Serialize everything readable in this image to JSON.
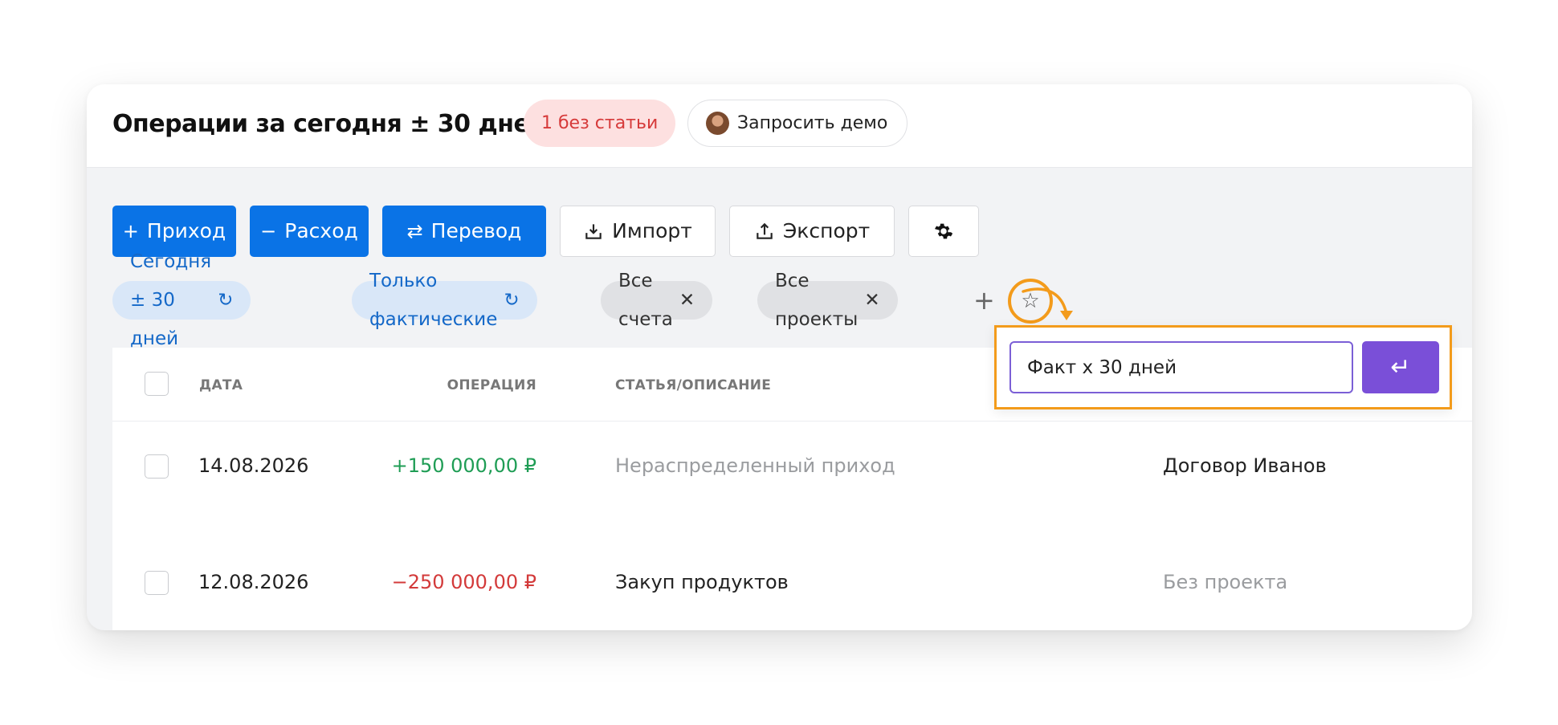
{
  "header": {
    "title": "Операции за сегодня ± 30 дней",
    "badge": "1 без статьи",
    "demo_button": "Запросить демо"
  },
  "toolbar": {
    "income": {
      "icon": "+",
      "label": "Приход"
    },
    "expense": {
      "icon": "−",
      "label": "Расход"
    },
    "transfer": {
      "icon": "⇄",
      "label": "Перевод"
    },
    "import": {
      "icon": "import-icon",
      "label": "Импорт"
    },
    "export": {
      "icon": "export-icon",
      "label": "Экспорт"
    },
    "settings": {
      "icon": "gear-icon"
    }
  },
  "filters": [
    {
      "label": "Сегодня ± 30 дней",
      "action": "↻"
    },
    {
      "label": "Только фактические",
      "action": "↻"
    },
    {
      "label": "Все счета",
      "action": "✕"
    },
    {
      "label": "Все проекты",
      "action": "✕"
    }
  ],
  "add_filter": "+",
  "favorite_icon": "☆",
  "save_filter": {
    "value": "Факт x 30 дней",
    "submit_icon": "↵"
  },
  "table": {
    "columns": {
      "date": "ДАТА",
      "operation": "ОПЕРАЦИЯ",
      "description": "СТАТЬЯ/ОПИСАНИЕ"
    },
    "rows": [
      {
        "date": "14.08.2026",
        "amount": "+150 000,00 ₽",
        "description": "Нераспределенный приход",
        "project": "Договор Иванов"
      },
      {
        "date": "12.08.2026",
        "amount": "−250 000,00 ₽",
        "description": "Закуп продуктов",
        "project": "Без проекта"
      }
    ]
  },
  "colors": {
    "primary": "#0a73e6",
    "accent_orange": "#f39b1b",
    "purple": "#7a4fd8",
    "positive": "#1f9d55",
    "negative": "#d33a3a"
  }
}
